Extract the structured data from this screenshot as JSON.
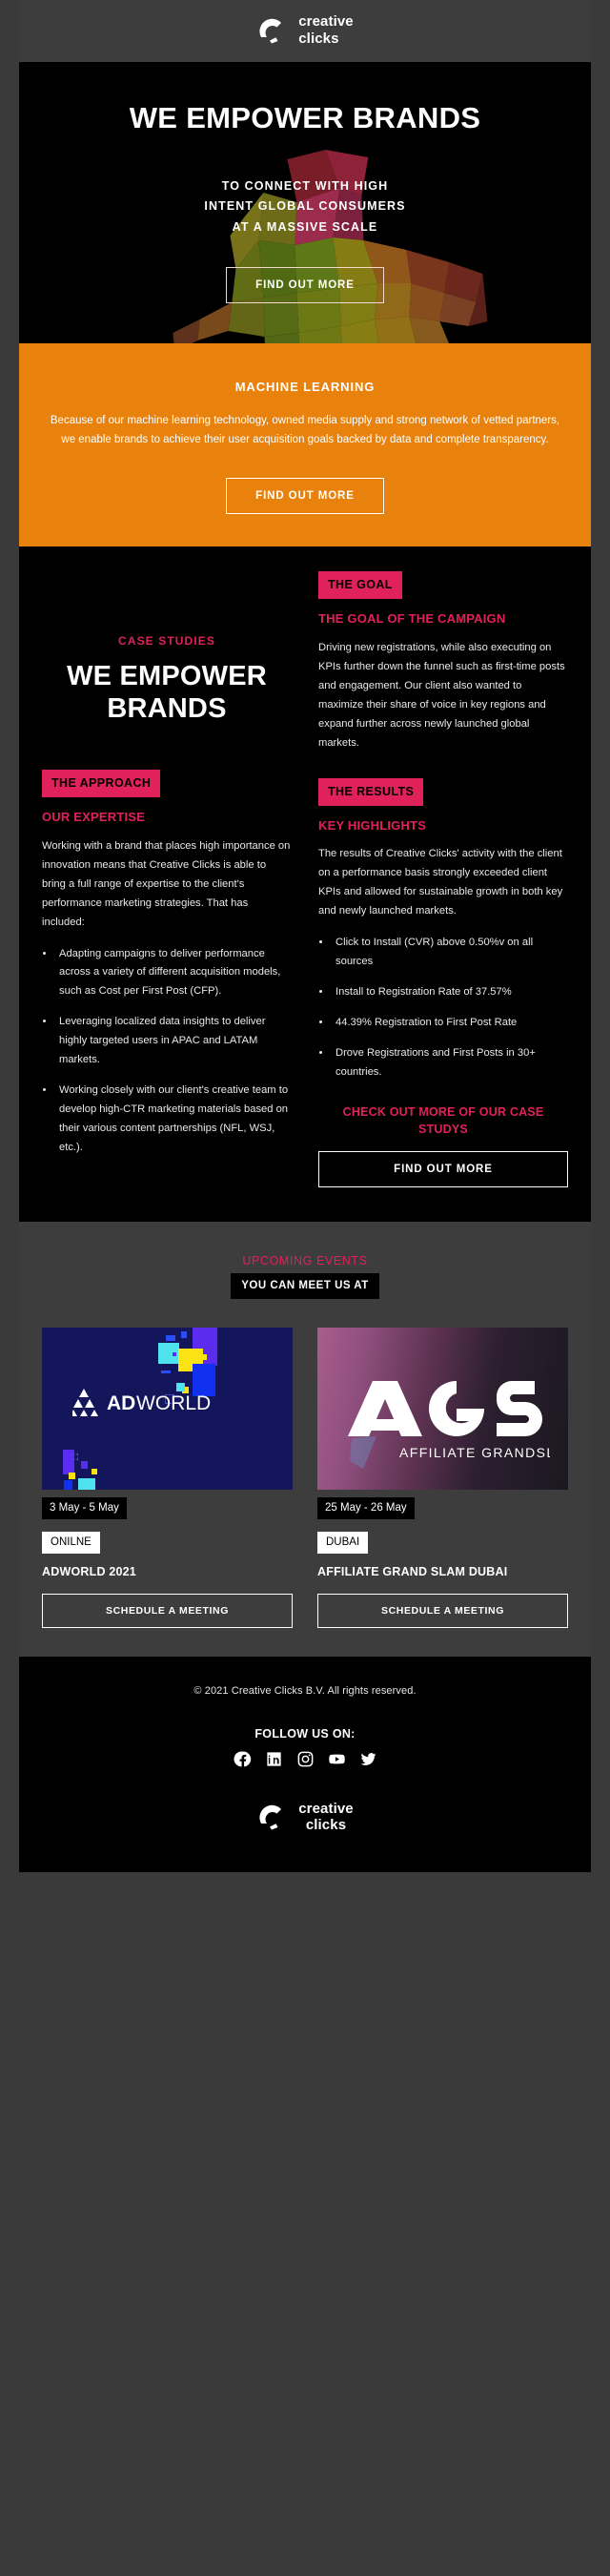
{
  "brand": {
    "name_line1": "creative",
    "name_line2": "clicks",
    "logo_icon": "creative-clicks-arc-logo",
    "pink": "#e0215a",
    "orange": "#e8820c"
  },
  "hero": {
    "title": "WE EMPOWER BRANDS",
    "subtitle_line1": "TO CONNECT WITH HIGH",
    "subtitle_line2": "INTENT GLOBAL CONSUMERS",
    "subtitle_line3": "AT A MASSIVE SCALE",
    "cta_label": "FIND OUT MORE",
    "background_art": "low-poly-runner-illustration"
  },
  "machine_learning": {
    "title": "MACHINE LEARNING",
    "body": "Because of our machine learning technology, owned media supply and strong network of vetted partners, we enable brands to achieve their user acquisition goals backed by data and complete transparency.",
    "cta_label": "FIND OUT MORE"
  },
  "case_studies": {
    "kicker": "CASE STUDIES",
    "heading": "WE EMPOWER BRANDS",
    "goal": {
      "tag": "THE GOAL",
      "subtitle": "THE GOAL OF THE CAMPAIGN",
      "body": "Driving new registrations, while also executing on KPIs further down the funnel such as first-time posts and engagement. Our client also wanted to maximize their share of voice in key regions and expand further across newly launched global markets."
    },
    "approach": {
      "tag": "THE APPROACH",
      "subtitle": "OUR EXPERTISE",
      "body": "Working with a brand that places high importance on innovation means that Creative Clicks is able to bring a full range of expertise to the client's performance marketing strategies. That has included:",
      "bullets": [
        "Adapting campaigns to deliver performance across a variety of different acquisition models, such as Cost per First Post (CFP).",
        "Leveraging localized data insights to deliver highly targeted users in APAC and LATAM markets.",
        "Working closely with our client's creative team to develop high-CTR marketing materials based on their various content partnerships (NFL, WSJ, etc.)."
      ]
    },
    "results": {
      "tag": "THE RESULTS",
      "subtitle": "KEY HIGHLIGHTS",
      "body": "The results of Creative Clicks' activity with the client on a performance basis strongly exceeded client KPIs and allowed for sustainable growth in both key and newly launched markets.",
      "bullets": [
        "Click to Install (CVR) above 0.50%v on all sources",
        "Install to Registration Rate of 37.57%",
        "44.39% Registration to First Post Rate",
        "Drove Registrations and First Posts in 30+ countries."
      ],
      "cta_text": "CHECK OUT MORE OF OUR CASE STUDYS",
      "cta_label": "FIND OUT MORE"
    }
  },
  "events": {
    "kicker": "UPCOMING EVENTS",
    "badge": "YOU CAN MEET US AT",
    "items": [
      {
        "logo_text_bold": "AD",
        "logo_text_light": "WORLD",
        "logo_icon": "adworld-triangle-logo",
        "date": "3 May - 5 May",
        "location": "ONILNE",
        "title": "ADWORLD 2021",
        "cta_label": "SCHEDULE A MEETING"
      },
      {
        "logo_text": "AGS",
        "logo_subtext": "AFFILIATE GRANDSLAM",
        "logo_icon": "ags-logo",
        "date": "25 May - 26 May",
        "location": "DUBAI",
        "title": "AFFILIATE GRAND SLAM DUBAI",
        "cta_label": "SCHEDULE A MEETING"
      }
    ]
  },
  "footer": {
    "copyright": "© 2021 Creative Clicks B.V. All rights reserved.",
    "follow_label": "FOLLOW US ON:",
    "socials": [
      {
        "name": "facebook-icon"
      },
      {
        "name": "linkedin-icon"
      },
      {
        "name": "instagram-icon"
      },
      {
        "name": "youtube-icon"
      },
      {
        "name": "twitter-icon"
      }
    ]
  }
}
